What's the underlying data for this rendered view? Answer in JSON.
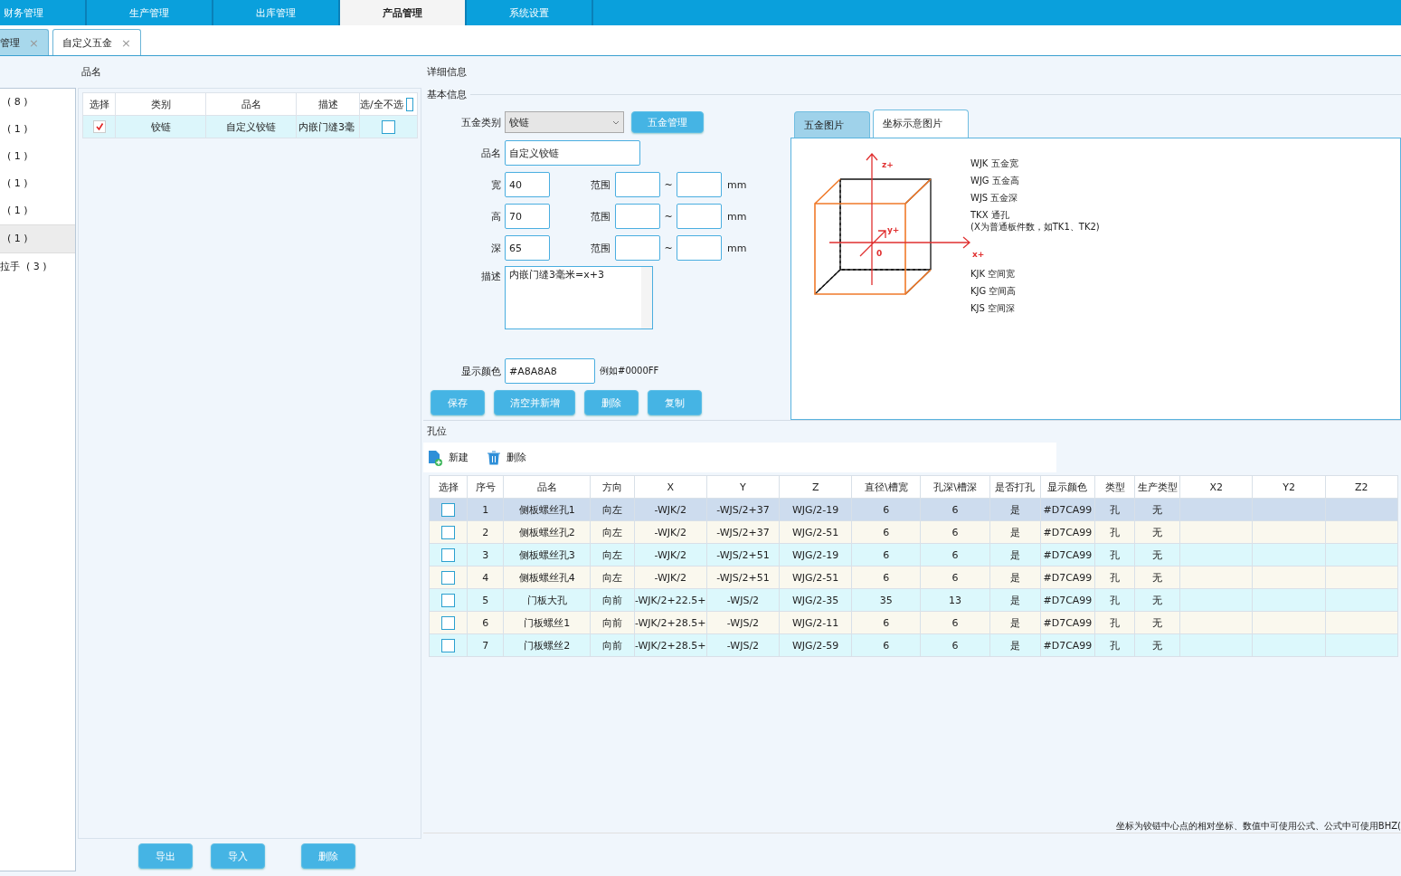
{
  "nav_tabs": [
    {
      "label": "财务管理",
      "selected": false
    },
    {
      "label": "生产管理",
      "selected": false
    },
    {
      "label": "出库管理",
      "selected": false
    },
    {
      "label": "产品管理",
      "selected": true
    },
    {
      "label": "系统设置",
      "selected": false
    }
  ],
  "doc_tabs": [
    {
      "label": "管理",
      "selected": false,
      "close": "×"
    },
    {
      "label": "自定义五金",
      "selected": true,
      "close": "×"
    }
  ],
  "category_list": [
    {
      "label": "( 8 )",
      "selected": false
    },
    {
      "label": "( 1 )",
      "selected": false
    },
    {
      "label": "( 1 )",
      "selected": false
    },
    {
      "label": "( 1 )",
      "selected": false
    },
    {
      "label": "( 1 )",
      "selected": false
    },
    {
      "label": "( 1 )",
      "selected": true
    },
    {
      "label": "拉手  ( 3 )",
      "selected": false
    }
  ],
  "items": {
    "heading": "品名",
    "header_checked": false,
    "columns": [
      "选择",
      "类别",
      "品名",
      "描述",
      "选/全不选"
    ],
    "rows": [
      {
        "checked": true,
        "toggle": false,
        "cells": [
          "",
          "铰链",
          "自定义铰链",
          "内嵌门缝3毫"
        ]
      }
    ]
  },
  "bottom_buttons": [
    "导出",
    "导入",
    "删除"
  ],
  "detail": {
    "heading": "详细信息",
    "group": "基本信息",
    "category": {
      "label": "五金类别",
      "value": "铰链"
    },
    "manage_button": "五金管理",
    "name": {
      "label": "品名",
      "value": "自定义铰链"
    },
    "dims": [
      {
        "label": "宽",
        "value": "40",
        "range_label": "范围",
        "tilde": "~",
        "unit": "mm"
      },
      {
        "label": "高",
        "value": "70",
        "range_label": "范围",
        "tilde": "~",
        "unit": "mm"
      },
      {
        "label": "深",
        "value": "65",
        "range_label": "范围",
        "tilde": "~",
        "unit": "mm"
      }
    ],
    "description": {
      "label": "描述",
      "value": "内嵌门缝3毫米=x+3"
    },
    "color": {
      "label": "显示颜色",
      "value": "#A8A8A8",
      "hint": "例如#0000FF"
    },
    "actions": [
      "保存",
      "清空并新增",
      "删除",
      "复制"
    ]
  },
  "image_tabs": [
    {
      "label": "五金图片",
      "selected": false
    },
    {
      "label": "坐标示意图片",
      "selected": true
    }
  ],
  "diagram": {
    "z": "z+",
    "y": "y+",
    "x": "x+",
    "origin": "0",
    "legend_top": [
      "WJK 五金宽",
      "WJG 五金高",
      "WJS 五金深",
      "TKX 通孔"
    ],
    "legend_note": "(X为普通板件数，如TK1、TK2)",
    "legend_bottom": [
      "KJK 空间宽",
      "KJG 空间高",
      "KJS 空间深"
    ]
  },
  "holes": {
    "heading": "孔位",
    "toolbar": [
      {
        "kind": "new",
        "label": "新建"
      },
      {
        "kind": "delete",
        "label": "删除"
      }
    ],
    "columns": [
      "选择",
      "序号",
      "品名",
      "方向",
      "X",
      "Y",
      "Z",
      "直径\\槽宽",
      "孔深\\槽深",
      "是否打孔",
      "显示颜色",
      "类型",
      "生产类型",
      "X2",
      "Y2",
      "Z2"
    ],
    "rows": [
      {
        "selected": true,
        "checked": false,
        "cells": [
          "",
          "1",
          "侧板螺丝孔1",
          "向左",
          "-WJK/2",
          "-WJS/2+37",
          "WJG/2-19",
          "6",
          "6",
          "是",
          "#D7CA99",
          "孔",
          "无"
        ]
      },
      {
        "selected": false,
        "checked": false,
        "cells": [
          "",
          "2",
          "侧板螺丝孔2",
          "向左",
          "-WJK/2",
          "-WJS/2+37",
          "WJG/2-51",
          "6",
          "6",
          "是",
          "#D7CA99",
          "孔",
          "无"
        ]
      },
      {
        "selected": false,
        "checked": false,
        "cells": [
          "",
          "3",
          "侧板螺丝孔3",
          "向左",
          "-WJK/2",
          "-WJS/2+51",
          "WJG/2-19",
          "6",
          "6",
          "是",
          "#D7CA99",
          "孔",
          "无"
        ]
      },
      {
        "selected": false,
        "checked": false,
        "cells": [
          "",
          "4",
          "侧板螺丝孔4",
          "向左",
          "-WJK/2",
          "-WJS/2+51",
          "WJG/2-51",
          "6",
          "6",
          "是",
          "#D7CA99",
          "孔",
          "无"
        ]
      },
      {
        "selected": false,
        "checked": false,
        "cells": [
          "",
          "5",
          "门板大孔",
          "向前",
          "-WJK/2+22.5+",
          "-WJS/2",
          "WJG/2-35",
          "35",
          "13",
          "是",
          "#D7CA99",
          "孔",
          "无"
        ]
      },
      {
        "selected": false,
        "checked": false,
        "cells": [
          "",
          "6",
          "门板螺丝1",
          "向前",
          "-WJK/2+28.5+",
          "-WJS/2",
          "WJG/2-11",
          "6",
          "6",
          "是",
          "#D7CA99",
          "孔",
          "无"
        ]
      },
      {
        "selected": false,
        "checked": false,
        "cells": [
          "",
          "7",
          "门板螺丝2",
          "向前",
          "-WJK/2+28.5+",
          "-WJS/2",
          "WJG/2-59",
          "6",
          "6",
          "是",
          "#D7CA99",
          "孔",
          "无"
        ]
      }
    ],
    "note": "坐标为铰链中心点的相对坐标、数值中可使用公式、公式中可使用BHZ("
  }
}
